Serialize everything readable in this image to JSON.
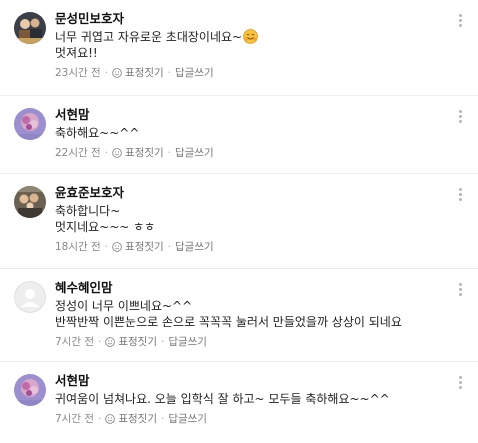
{
  "comments": [
    {
      "author": "문성민보호자",
      "lines": [
        "너무 귀엽고 자유로운 초대장이네요~",
        "멋져요!!"
      ],
      "time": "23시간 전",
      "emoji_label": "표정짓기",
      "reply_label": "답글쓰기",
      "avatar": "photo-dark"
    },
    {
      "author": "서현맘",
      "lines": [
        "축하해요~~^^"
      ],
      "time": "22시간 전",
      "emoji_label": "표정짓기",
      "reply_label": "답글쓰기",
      "avatar": "photo-purple"
    },
    {
      "author": "윤효준보호자",
      "lines": [
        "축하합니다~",
        "멋지네요~~~ ㅎㅎ"
      ],
      "time": "18시간 전",
      "emoji_label": "표정짓기",
      "reply_label": "답글쓰기",
      "avatar": "photo-family"
    },
    {
      "author": "혜수혜인맘",
      "lines": [
        "정성이 너무 이쁘네요~^^",
        "반짝반짝 이쁜눈으로 손으로 꼭꼭꼭 눌러서 만들었을까 상상이 되네요"
      ],
      "time": "7시간 전",
      "emoji_label": "표정짓기",
      "reply_label": "답글쓰기",
      "avatar": "default-person"
    },
    {
      "author": "서현맘",
      "lines": [
        "귀여움이 넘쳐나요. 오늘 입학식 잘 하고~  모두들 축하해요~~^^"
      ],
      "time": "7시간 전",
      "emoji_label": "표정짓기",
      "reply_label": "답글쓰기",
      "avatar": "photo-purple"
    }
  ],
  "icons": {
    "emoji_button": "smile-icon",
    "more_button": "more-vertical-icon",
    "inline_emoji": "smiling-face-emoji"
  },
  "colors": {
    "meta_text": "#888888",
    "divider": "#ececec",
    "author_text": "#111111"
  }
}
